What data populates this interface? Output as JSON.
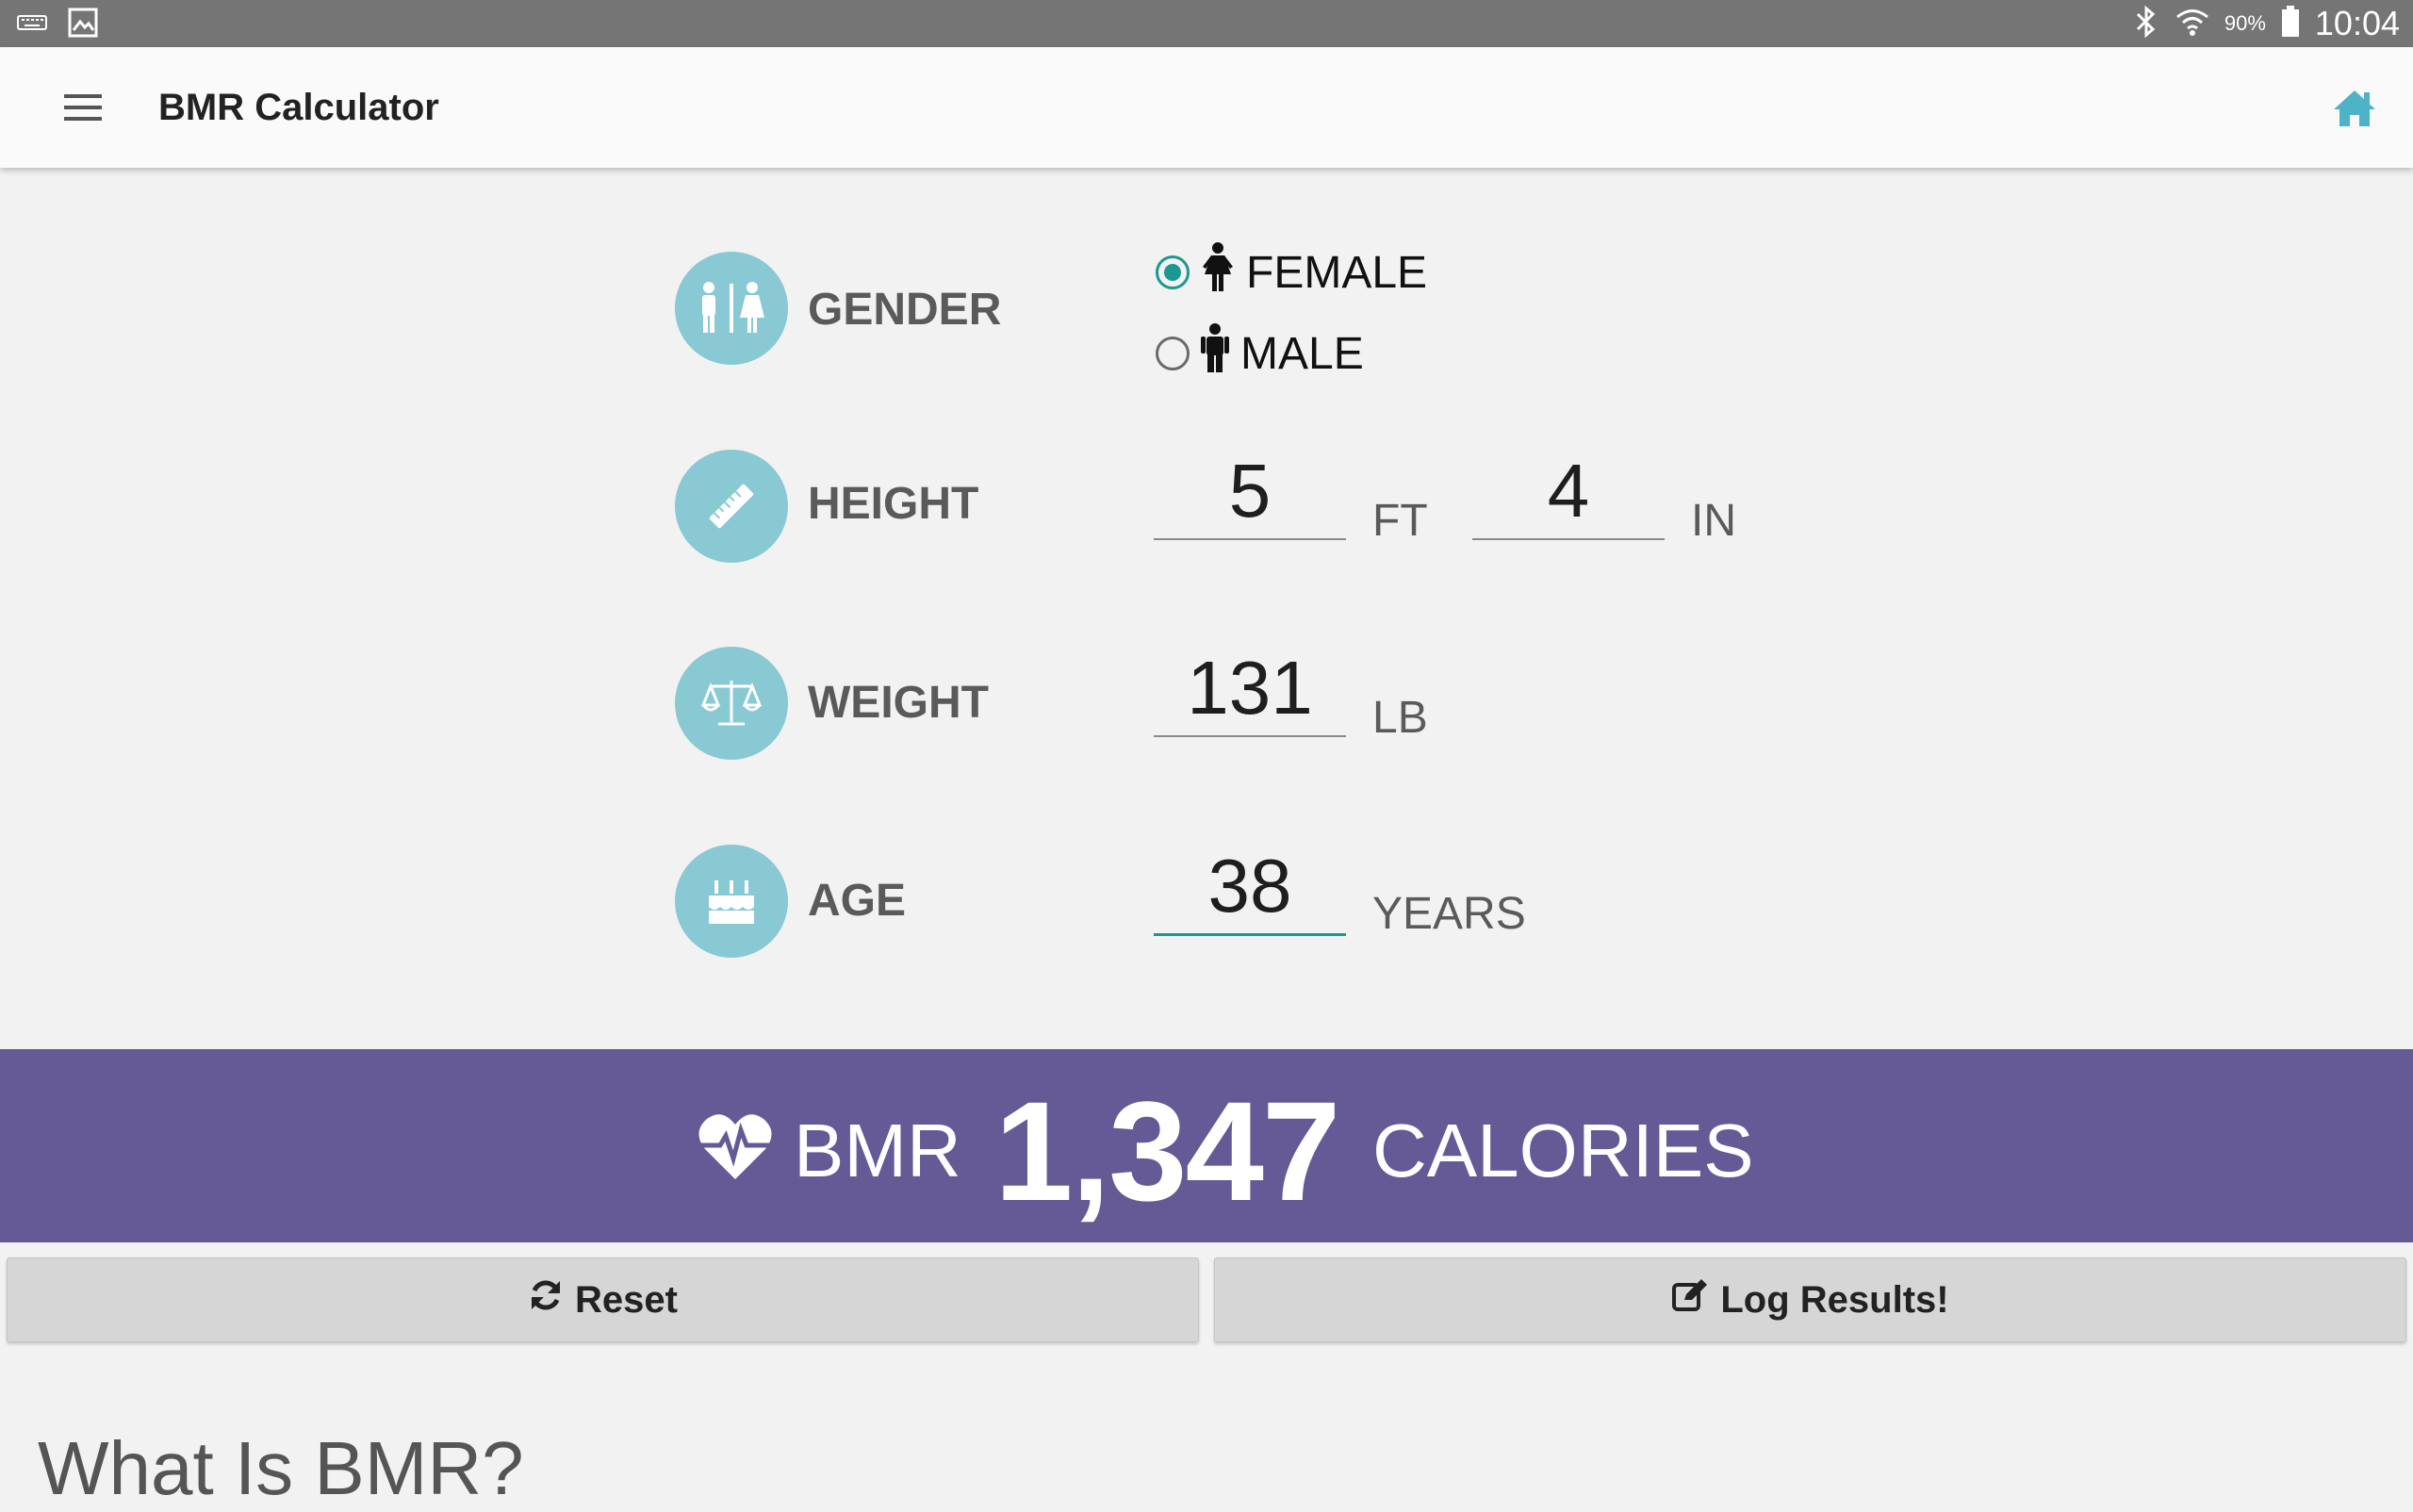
{
  "status_bar": {
    "battery_pct": "90%",
    "clock": "10:04",
    "icons": [
      "keyboard-icon",
      "gallery-icon",
      "bluetooth-icon",
      "wifi-icon",
      "battery-icon"
    ]
  },
  "app_bar": {
    "title": "BMR Calculator",
    "accent_color": "#4fb3c8"
  },
  "form": {
    "gender": {
      "label": "GENDER",
      "options": [
        {
          "label": "FEMALE",
          "selected": true
        },
        {
          "label": "MALE",
          "selected": false
        }
      ]
    },
    "height": {
      "label": "HEIGHT",
      "feet": "5",
      "feet_unit": "FT",
      "inches": "4",
      "inches_unit": "IN"
    },
    "weight": {
      "label": "WEIGHT",
      "value": "131",
      "unit": "LB"
    },
    "age": {
      "label": "AGE",
      "value": "38",
      "unit": "YEARS"
    }
  },
  "result": {
    "prefix": "BMR",
    "value": "1,347",
    "unit": "CALORIES",
    "banner_color": "#655996"
  },
  "buttons": {
    "reset": "Reset",
    "log": "Log Results!"
  },
  "info": {
    "heading": "What Is BMR?"
  }
}
